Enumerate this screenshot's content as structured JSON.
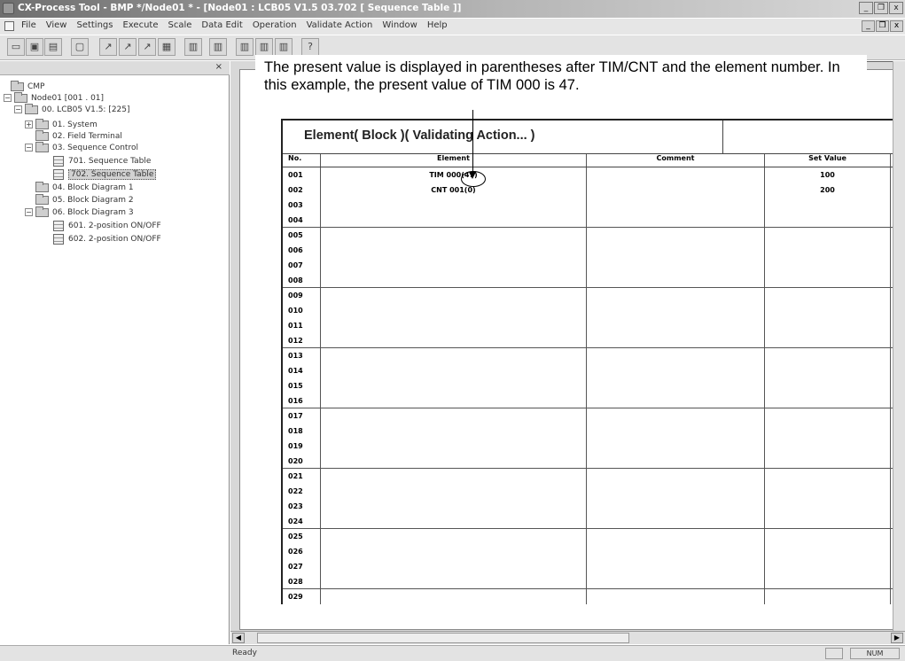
{
  "window": {
    "title": "CX-Process Tool - BMP */Node01 * - [Node01 : LCB05 V1.5 03.702 [ Sequence Table ]]",
    "min": "_",
    "max": "❐",
    "close": "x"
  },
  "menu": [
    "File",
    "View",
    "Settings",
    "Execute",
    "Scale",
    "Data Edit",
    "Operation",
    "Validate Action",
    "Window",
    "Help"
  ],
  "toolbar_icons": [
    "▭",
    "▣",
    "▤",
    "▢",
    "↗",
    "↗",
    "↗",
    "▦",
    "▥",
    "▥",
    "▥",
    "▥",
    "▥",
    "?"
  ],
  "tree": {
    "root": "CMP",
    "items": [
      {
        "label": "Node01 [001 . 01]"
      },
      {
        "label": "00. LCB05 V1.5: [225]"
      },
      {
        "label": "01. System"
      },
      {
        "label": "02. Field Terminal"
      },
      {
        "label": "03. Sequence Control"
      },
      {
        "label": "701. Sequence Table"
      },
      {
        "label": "702. Sequence Table"
      },
      {
        "label": "04. Block Diagram 1"
      },
      {
        "label": "05. Block Diagram 2"
      },
      {
        "label": "06. Block Diagram 3"
      },
      {
        "label": "601. 2-position ON/OFF"
      },
      {
        "label": "602. 2-position ON/OFF"
      }
    ]
  },
  "callout": {
    "text": "The present value is displayed in parentheses after TIM/CNT and the element number. In this example, the present value of TIM 000 is 47."
  },
  "sequence_table": {
    "title": "Element( Block )( Validating Action... )",
    "columns": {
      "no": "No.",
      "element": "Element",
      "comment": "Comment",
      "set_value": "Set Value"
    },
    "rows": [
      {
        "no": "001",
        "element": "TIM 000(47)",
        "set_value": "100"
      },
      {
        "no": "002",
        "element": "CNT 001(0)",
        "set_value": "200"
      },
      {
        "no": "003"
      },
      {
        "no": "004"
      },
      {
        "no": "005"
      },
      {
        "no": "006"
      },
      {
        "no": "007"
      },
      {
        "no": "008"
      },
      {
        "no": "009"
      },
      {
        "no": "010"
      },
      {
        "no": "011"
      },
      {
        "no": "012"
      },
      {
        "no": "013"
      },
      {
        "no": "014"
      },
      {
        "no": "015"
      },
      {
        "no": "016"
      },
      {
        "no": "017"
      },
      {
        "no": "018"
      },
      {
        "no": "019"
      },
      {
        "no": "020"
      },
      {
        "no": "021"
      },
      {
        "no": "022"
      },
      {
        "no": "023"
      },
      {
        "no": "024"
      },
      {
        "no": "025"
      },
      {
        "no": "026"
      },
      {
        "no": "027"
      },
      {
        "no": "028"
      },
      {
        "no": "029"
      }
    ]
  },
  "status": {
    "ready": "Ready",
    "num": "NUM"
  }
}
